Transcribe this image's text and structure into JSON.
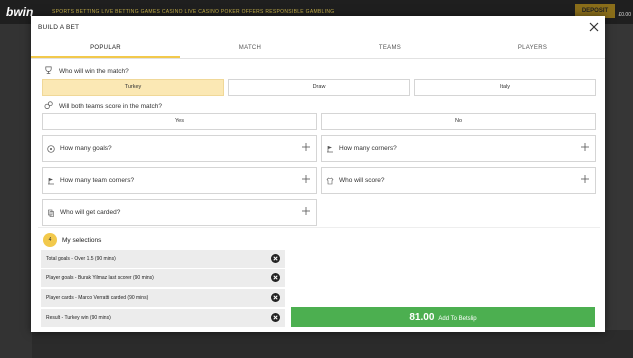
{
  "background": {
    "logo": "bwin",
    "nav": "SPORTS BETTING   LIVE BETTING   GAMES   CASINO   LIVE CASINO   POKER   OFFERS   RESPONSIBLE GAMBLING",
    "deposit": "DEPOSIT",
    "balance": "£0.00"
  },
  "modal": {
    "title": "BUILD A BET",
    "tabs": [
      {
        "label": "POPULAR"
      },
      {
        "label": "MATCH"
      },
      {
        "label": "TEAMS"
      },
      {
        "label": "PLAYERS"
      }
    ],
    "q1": {
      "label": "Who will win the match?",
      "options": [
        {
          "label": "Turkey"
        },
        {
          "label": "Draw"
        },
        {
          "label": "Italy"
        }
      ]
    },
    "q2": {
      "label": "Will both teams score in the match?",
      "options": [
        {
          "label": "Yes"
        },
        {
          "label": "No"
        }
      ]
    },
    "markets": [
      {
        "label": "How many goals?"
      },
      {
        "label": "How many corners?"
      },
      {
        "label": "How many team corners?"
      },
      {
        "label": "Who will score?"
      },
      {
        "label": "Who will get carded?"
      }
    ],
    "selections": {
      "count": "4",
      "title": "My selections",
      "items": [
        {
          "label": "Total goals - Over 1.5 (90 mins)"
        },
        {
          "label": "Player goals - Burak Yilmaz last scorer (90 mins)"
        },
        {
          "label": "Player cards - Marco Verratti carded (90 mins)"
        },
        {
          "label": "Result - Turkey win (90 mins)"
        }
      ],
      "odds": "81.00",
      "add_label": "Add To Betslip"
    }
  },
  "colors": {
    "accent": "#f2c94c",
    "selected_bg": "#fbe8b4",
    "add_button": "#4caf50"
  }
}
